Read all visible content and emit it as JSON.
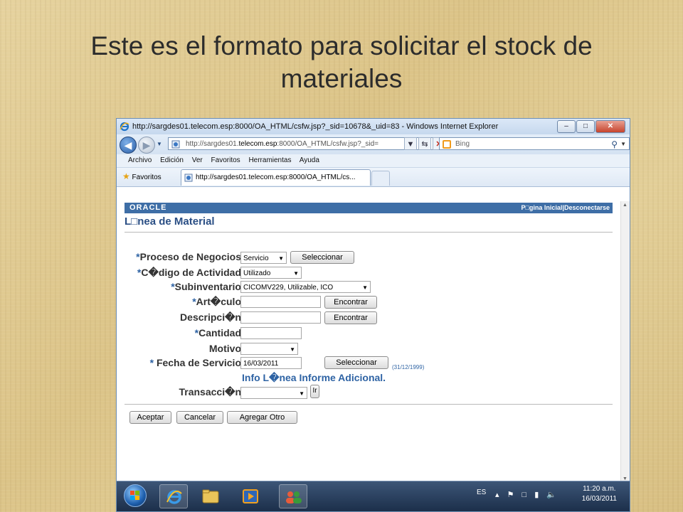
{
  "slide": {
    "title": "Este es el formato para solicitar el stock de materiales"
  },
  "browser": {
    "window_title": "http://sargdes01.telecom.esp:8000/OA_HTML/csfw.jsp?_sid=10678&_uid=83 - Windows Internet Explorer",
    "address_prefix": "http://sargdes01.",
    "address_domain": "telecom.esp",
    "address_suffix": ":8000/OA_HTML/csfw.jsp?_sid=",
    "search_placeholder": "Bing",
    "menu": [
      "Archivo",
      "Edición",
      "Ver",
      "Favoritos",
      "Herramientas",
      "Ayuda"
    ],
    "favorites_label": "Favoritos",
    "tab_label": "http://sargdes01.telecom.esp:8000/OA_HTML/cs..."
  },
  "app": {
    "brand": "ORACLE",
    "header_links": "P□gina Inicial|Desconectarse",
    "page_heading": "L□nea de Material"
  },
  "form": {
    "proceso_label": "Proceso de Negocios",
    "proceso_value": "Servicio",
    "proceso_button": "Seleccionar",
    "codigo_label": "C�digo de Actividad",
    "codigo_value": "Utilizado",
    "subinv_label": "Subinventario",
    "subinv_value": "CICOMV229, Utilizable, ICO",
    "articulo_label": "Art�culo",
    "articulo_value": "",
    "articulo_button": "Encontrar",
    "descripcion_label": "Descripci�n",
    "descripcion_value": "",
    "descripcion_button": "Encontrar",
    "cantidad_label": "Cantidad",
    "cantidad_value": "",
    "motivo_label": "Motivo",
    "motivo_value": "",
    "fecha_label": "Fecha de Servicio",
    "fecha_value": "16/03/2011",
    "fecha_button": "Seleccionar",
    "fecha_hint": "(31/12/1999)",
    "info_link": "Info L�nea Informe Adicional.",
    "transaccion_label": "Transacci�n",
    "transaccion_value": "",
    "ir_button": "Ir",
    "required_mark": "*"
  },
  "actions": {
    "aceptar": "Aceptar",
    "cancelar": "Cancelar",
    "agregar": "Agregar Otro"
  },
  "taskbar": {
    "language": "ES",
    "time": "11:20 a.m.",
    "date": "16/03/2011"
  },
  "colors": {
    "oracle_bar": "#3e6ea6",
    "heading": "#2b4f85",
    "required": "#2e63a4"
  }
}
